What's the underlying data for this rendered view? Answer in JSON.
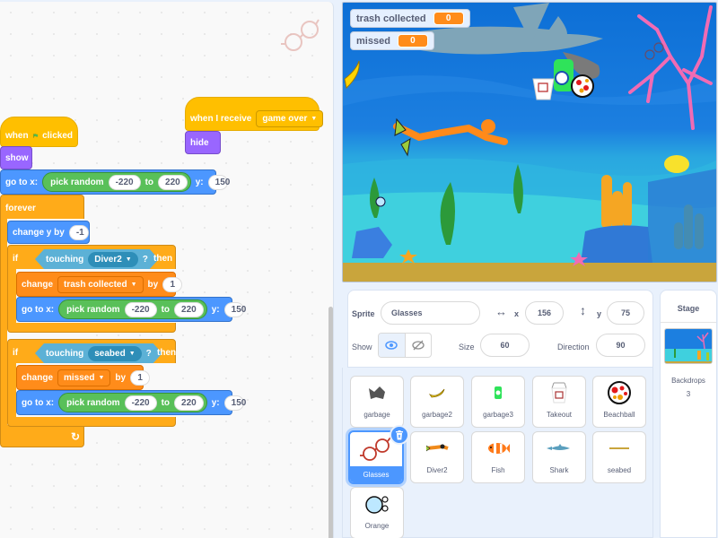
{
  "scripts": {
    "script1": {
      "hat_when": "when",
      "hat_clicked": "clicked",
      "show": "show",
      "goto_label": "go to x:",
      "pick_random": "pick random",
      "goto_from": "-220",
      "goto_to_label": "to",
      "goto_to": "220",
      "goto_y_label": "y:",
      "goto_y": "150",
      "forever": "forever",
      "change_y": "change y by",
      "change_y_value": "-1",
      "if1_if": "if",
      "if1_touching": "touching",
      "if1_target": "Diver2",
      "if1_q": "?",
      "if1_then": "then",
      "if1_change": "change",
      "if1_var": "trash collected",
      "if1_by": "by",
      "if1_by_value": "1",
      "if1_goto_label": "go to x:",
      "if1_pick": "pick random",
      "if1_from": "-220",
      "if1_to_label": "to",
      "if1_to": "220",
      "if1_y_label": "y:",
      "if1_y": "150",
      "if2_if": "if",
      "if2_touching": "touching",
      "if2_target": "seabed",
      "if2_q": "?",
      "if2_then": "then",
      "if2_change": "change",
      "if2_var": "missed",
      "if2_by": "by",
      "if2_by_value": "1",
      "if2_goto_label": "go to x:",
      "if2_pick": "pick random",
      "if2_from": "-220",
      "if2_to_label": "to",
      "if2_to": "220",
      "if2_y_label": "y:",
      "if2_y": "150"
    },
    "script2": {
      "hat_label": "when I receive",
      "message": "game over",
      "hide": "hide"
    }
  },
  "stage": {
    "monitors": [
      {
        "label": "trash collected",
        "value": "0"
      },
      {
        "label": "missed",
        "value": "0"
      }
    ]
  },
  "sprite_info": {
    "sprite_label": "Sprite",
    "sprite_name": "Glasses",
    "x_label": "x",
    "x_value": "156",
    "y_label": "y",
    "y_value": "75",
    "show_label": "Show",
    "size_label": "Size",
    "size_value": "60",
    "direction_label": "Direction",
    "direction_value": "90"
  },
  "sprites": [
    {
      "name": "garbage"
    },
    {
      "name": "garbage2"
    },
    {
      "name": "garbage3"
    },
    {
      "name": "Takeout"
    },
    {
      "name": "Beachball"
    },
    {
      "name": "Glasses",
      "selected": true
    },
    {
      "name": "Diver2"
    },
    {
      "name": "Fish"
    },
    {
      "name": "Shark"
    },
    {
      "name": "seabed"
    },
    {
      "name": "Orange"
    }
  ],
  "stage_panel": {
    "title": "Stage",
    "backdrops_label": "Backdrops",
    "backdrops_count": "3"
  },
  "colors": {
    "events": "#ffbf00",
    "looks": "#9966ff",
    "motion": "#4c97ff",
    "control": "#ffab19",
    "variables": "#ff8c1a",
    "operators": "#59c059",
    "sensing": "#5cb1d6",
    "selection": "#4c97ff"
  }
}
